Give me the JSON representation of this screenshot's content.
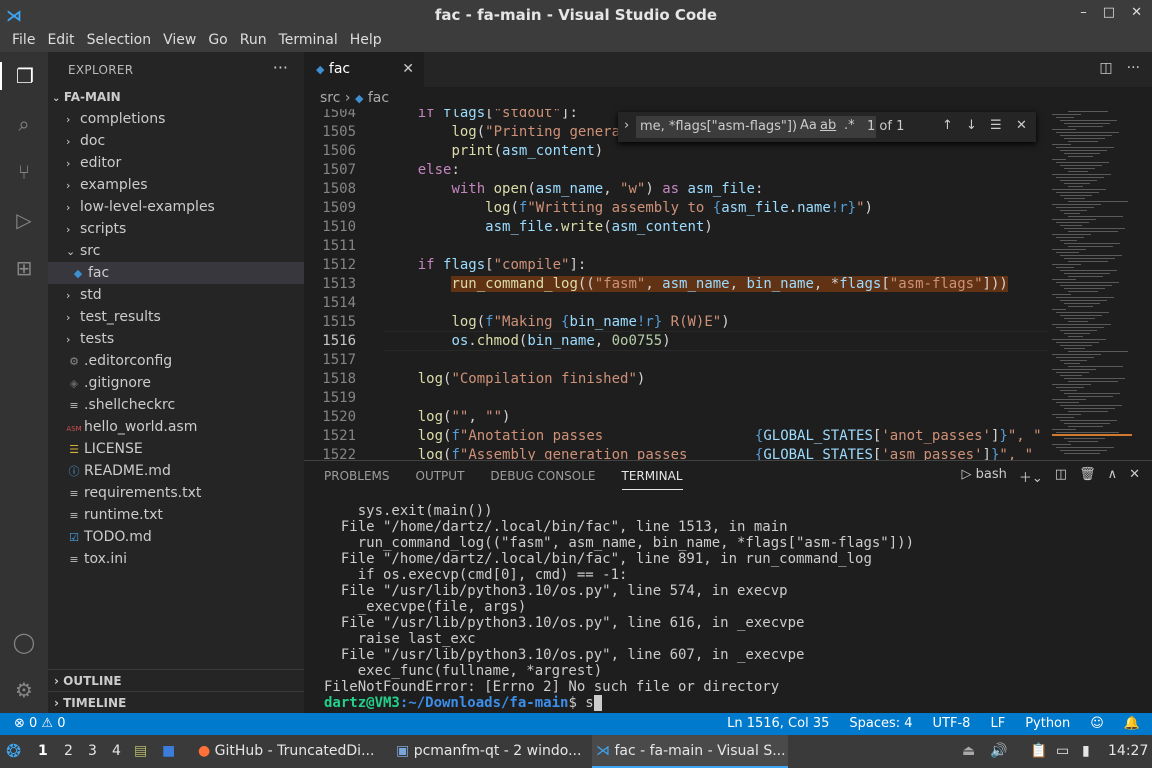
{
  "window": {
    "title": "fac - fa-main - Visual Studio Code",
    "min": "–",
    "max": "□",
    "close": "✕"
  },
  "menu": [
    "File",
    "Edit",
    "Selection",
    "View",
    "Go",
    "Run",
    "Terminal",
    "Help"
  ],
  "explorer": {
    "title": "EXPLORER",
    "more": "···",
    "root": "FA-MAIN",
    "items": [
      {
        "label": "completions",
        "type": "folder"
      },
      {
        "label": "doc",
        "type": "folder"
      },
      {
        "label": "editor",
        "type": "folder"
      },
      {
        "label": "examples",
        "type": "folder"
      },
      {
        "label": "low-level-examples",
        "type": "folder"
      },
      {
        "label": "scripts",
        "type": "folder"
      },
      {
        "label": "src",
        "type": "folder-open"
      },
      {
        "label": "fac",
        "type": "file-py"
      },
      {
        "label": "std",
        "type": "folder"
      },
      {
        "label": "test_results",
        "type": "folder"
      },
      {
        "label": "tests",
        "type": "folder"
      },
      {
        "label": ".editorconfig",
        "type": "gear"
      },
      {
        "label": ".gitignore",
        "type": "git"
      },
      {
        "label": ".shellcheckrc",
        "type": "lines"
      },
      {
        "label": "hello_world.asm",
        "type": "asm"
      },
      {
        "label": "LICENSE",
        "type": "license"
      },
      {
        "label": "README.md",
        "type": "info"
      },
      {
        "label": "requirements.txt",
        "type": "lines"
      },
      {
        "label": "runtime.txt",
        "type": "lines"
      },
      {
        "label": "TODO.md",
        "type": "check"
      },
      {
        "label": "tox.ini",
        "type": "lines"
      }
    ],
    "outline": "OUTLINE",
    "timeline": "TIMELINE"
  },
  "tab": {
    "label": "fac",
    "close": "✕"
  },
  "breadcrumb": {
    "folder": "src",
    "file": "fac"
  },
  "find": {
    "query": "me, *flags[\"asm-flags\"])",
    "case": "Aa",
    "word": "ab",
    "regex": ".*",
    "count": "1 of 1"
  },
  "lines": [
    1504,
    1505,
    1506,
    1507,
    1508,
    1509,
    1510,
    1511,
    1512,
    1513,
    1514,
    1515,
    1516,
    1517,
    1518,
    1519,
    1520,
    1521,
    1522
  ],
  "panel": {
    "tabs": [
      "PROBLEMS",
      "OUTPUT",
      "DEBUG CONSOLE",
      "TERMINAL"
    ],
    "shell": "bash"
  },
  "terminal": [
    "    sys.exit(main())",
    "  File \"/home/dartz/.local/bin/fac\", line 1513, in main",
    "    run_command_log((\"fasm\", asm_name, bin_name, *flags[\"asm-flags\"]))",
    "  File \"/home/dartz/.local/bin/fac\", line 891, in run_command_log",
    "    if os.execvp(cmd[0], cmd) == -1:",
    "  File \"/usr/lib/python3.10/os.py\", line 574, in execvp",
    "    _execvpe(file, args)",
    "  File \"/usr/lib/python3.10/os.py\", line 616, in _execvpe",
    "    raise last_exc",
    "  File \"/usr/lib/python3.10/os.py\", line 607, in _execvpe",
    "    exec_func(fullname, *argrest)",
    "FileNotFoundError: [Errno 2] No such file or directory"
  ],
  "prompt": {
    "user": "dartz@VM3",
    "path": ":~/Downloads/fa-main",
    "tail": "$ s"
  },
  "status": {
    "errors": "⊗ 0 ⚠ 0",
    "position": "Ln 1516, Col 35",
    "spaces": "Spaces: 4",
    "encoding": "UTF-8",
    "eol": "LF",
    "language": "Python"
  },
  "taskbar": {
    "ws": [
      "1",
      "2",
      "3",
      "4"
    ],
    "apps": [
      "GitHub - TruncatedDi...",
      "pcmanfm-qt - 2 windo...",
      "fac - fa-main - Visual S..."
    ],
    "clock": "14:27"
  }
}
